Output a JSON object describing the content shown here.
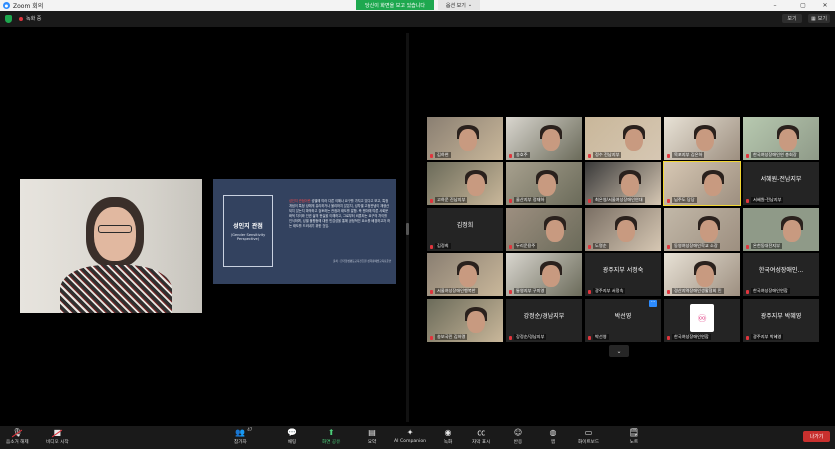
{
  "window": {
    "title": "Zoom 회의",
    "share_banner": "당신이 화면을 보고 있습니다",
    "view_options": "옵션 보기",
    "minimize": "–",
    "maximize": "▢",
    "close": "✕"
  },
  "meeting_bar": {
    "recording": "녹화 중",
    "view_btn": "보기",
    "gallery_btn": "보기"
  },
  "slide": {
    "title": "성인지 관점",
    "subtitle": "(Gender Sensitivity Perspective)",
    "body_highlight": "성인지 관점이란",
    "body_text": " 성별에 따라 다른 이해나 요구를 가지고 있다고 보고, 특정 개념이 특정 성에게 유리하거나 불리하지 않은지, 성차별 고정관념이 재생산되지 않는지 파악하고 검토하는 관점과 태도를 말함. 즉 젠더에 따른 사회문화적 차이와 인권 삶의 현실을 이해하고, 그로부터 비롯되는 요구의 차이를 인식하며, 성별 불평등에 대한 민감성을 통해 공정적인 요소를 배경하고자 하는 태도를 드러내기 위한 것임.",
    "source": "출처 : 한국양성평등교육진흥원 성희롱예방교육표준안"
  },
  "participants": [
    {
      "name": "김하현",
      "style": "cam"
    },
    {
      "name": "송호주",
      "style": "cam"
    },
    {
      "name": "정수 전남지부",
      "style": "cam"
    },
    {
      "name": "목포지부 김은하",
      "style": "cam"
    },
    {
      "name": "한국여성장애인연 총회장",
      "style": "cam"
    },
    {
      "name": "고하운 진남지부",
      "style": "cam"
    },
    {
      "name": "울산지부 정재하",
      "style": "cam"
    },
    {
      "name": "최은영/서울여성장애인연대",
      "style": "cam"
    },
    {
      "name": "님주도 당당",
      "style": "cam"
    },
    {
      "name": "서혜원-전남지부",
      "style": "name",
      "label": "서혜원-전남지부"
    },
    {
      "name": "김정희",
      "style": "name",
      "label": "김정희"
    },
    {
      "name": "두리운용주",
      "style": "cam"
    },
    {
      "name": "도명순",
      "style": "cam"
    },
    {
      "name": "동영여성장애인학교 소장",
      "style": "cam"
    },
    {
      "name": "온천동대전지부",
      "style": "cam"
    },
    {
      "name": "서울여성장애인행복한",
      "style": "cam"
    },
    {
      "name": "통영지부 구미영",
      "style": "cam"
    },
    {
      "name": "광주지부 서정숙",
      "style": "name",
      "label": "광주지부 서정숙"
    },
    {
      "name": "경산지역장애인생활협회 민",
      "style": "cam"
    },
    {
      "name": "한국여성장애인연합",
      "style": "name",
      "label": "한국여성장애인..."
    },
    {
      "name": "송보국민 김하명",
      "style": "cam"
    },
    {
      "name": "강정순/경남지부",
      "style": "name",
      "label": "강정순/경남지부"
    },
    {
      "name": "박선영",
      "style": "name",
      "label": "박선영"
    },
    {
      "name": "한국여성장애인연합",
      "style": "logo"
    },
    {
      "name": "광주지부 박혜영",
      "style": "name",
      "label": "광주지부 박혜영"
    }
  ],
  "more_btn": "⌄",
  "toolbar": {
    "audio": "음소거 해제",
    "video": "비디오 시작",
    "participants": "참가자",
    "participants_count": "47",
    "chat": "채팅",
    "share": "화면 공유",
    "summary": "요약",
    "companion": "AI Companion",
    "record": "녹화",
    "captions": "자막 표시",
    "reactions": "반응",
    "apps": "앱",
    "whiteboard": "화이트보드",
    "notes": "노트",
    "leave": "나가기"
  },
  "colors": {
    "accent_green": "#1ea84f",
    "leave_red": "#c8302e",
    "slide_bg": "#33425f",
    "active_speaker": "#f2d633"
  }
}
